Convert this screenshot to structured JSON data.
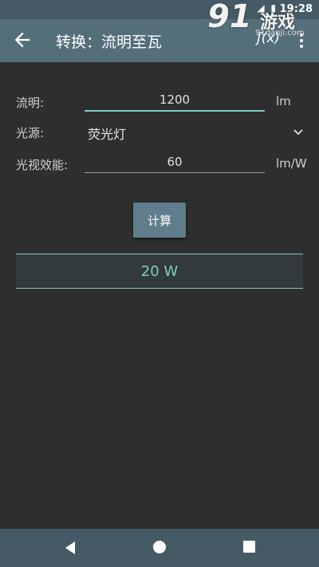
{
  "status": {
    "time": "19:28",
    "icons": "◢ ▮"
  },
  "watermark": {
    "brand": "91",
    "brand_cn": "游戏",
    "url": "91danji.com"
  },
  "appbar": {
    "title": "转换：流明至瓦",
    "fx_label": "ʃ(x)"
  },
  "form": {
    "lumen": {
      "label": "流明:",
      "value": "1200",
      "unit": "lm"
    },
    "source": {
      "label": "光源:",
      "value": "荧光灯"
    },
    "efficacy": {
      "label": "光视效能:",
      "value": "60",
      "unit": "lm/W"
    }
  },
  "calc_button": "计算",
  "result": "20 W",
  "colors": {
    "appbar": "#546e7a",
    "accent": "#80cbc4",
    "background": "#2e2e2e"
  }
}
